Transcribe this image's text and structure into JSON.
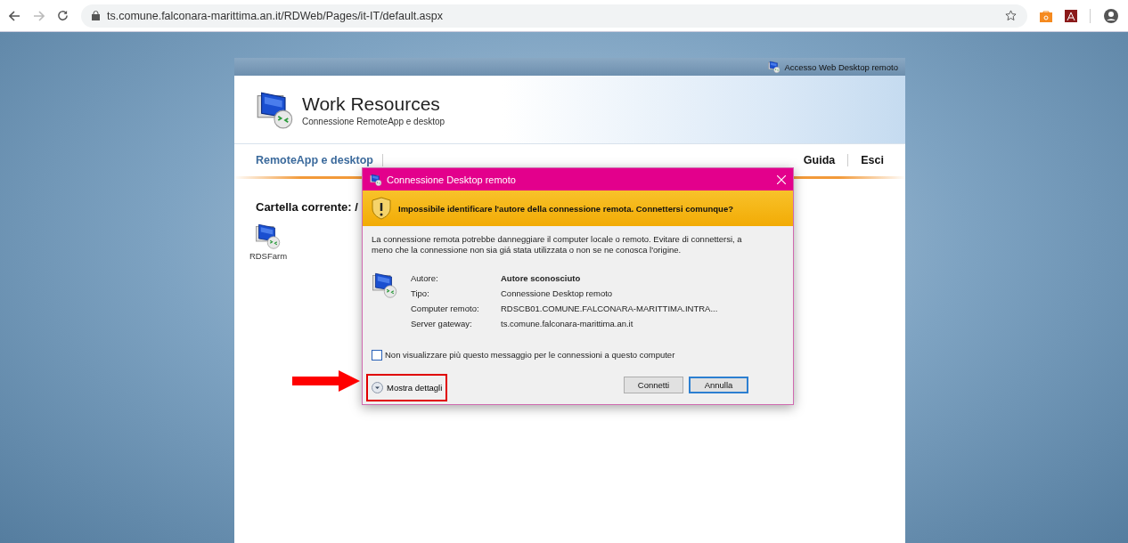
{
  "browser": {
    "url": "ts.comune.falconara-marittima.an.it/RDWeb/Pages/it-IT/default.aspx"
  },
  "portal": {
    "top_link": "Accesso Web Desktop remoto",
    "title": "Work Resources",
    "subtitle": "Connessione RemoteApp e desktop",
    "tabs": [
      {
        "label": "RemoteApp e desktop",
        "selected": true
      }
    ],
    "links": [
      "Guida",
      "Esci"
    ],
    "folder_label": "Cartella corrente: /",
    "resources": [
      {
        "name": "RDSFarm"
      }
    ]
  },
  "dialog": {
    "title": "Connessione Desktop remoto",
    "warning": "Impossibile identificare l'autore della connessione remota. Connettersi comunque?",
    "message": "La connessione remota potrebbe danneggiare il computer locale o remoto. Evitare di connettersi, a meno che la connessione non sia giá stata utilizzata o non se ne conosca l'origine.",
    "details": [
      {
        "label": "Autore:",
        "value": "Autore sconosciuto",
        "emphasis": true
      },
      {
        "label": "Tipo:",
        "value": "Connessione Desktop remoto",
        "emphasis": false
      },
      {
        "label": "Computer remoto:",
        "value": "RDSCB01.COMUNE.FALCONARA-MARITTIMA.INTRA...",
        "emphasis": false
      },
      {
        "label": "Server gateway:",
        "value": "ts.comune.falconara-marittima.an.it",
        "emphasis": false
      }
    ],
    "checkbox": {
      "label": "Non visualizzare più questo messaggio per le connessioni a questo computer",
      "checked": false
    },
    "toggle": "Mostra dettagli",
    "buttons": [
      {
        "label": "Connetti",
        "default": false
      },
      {
        "label": "Annulla",
        "default": true
      }
    ]
  }
}
